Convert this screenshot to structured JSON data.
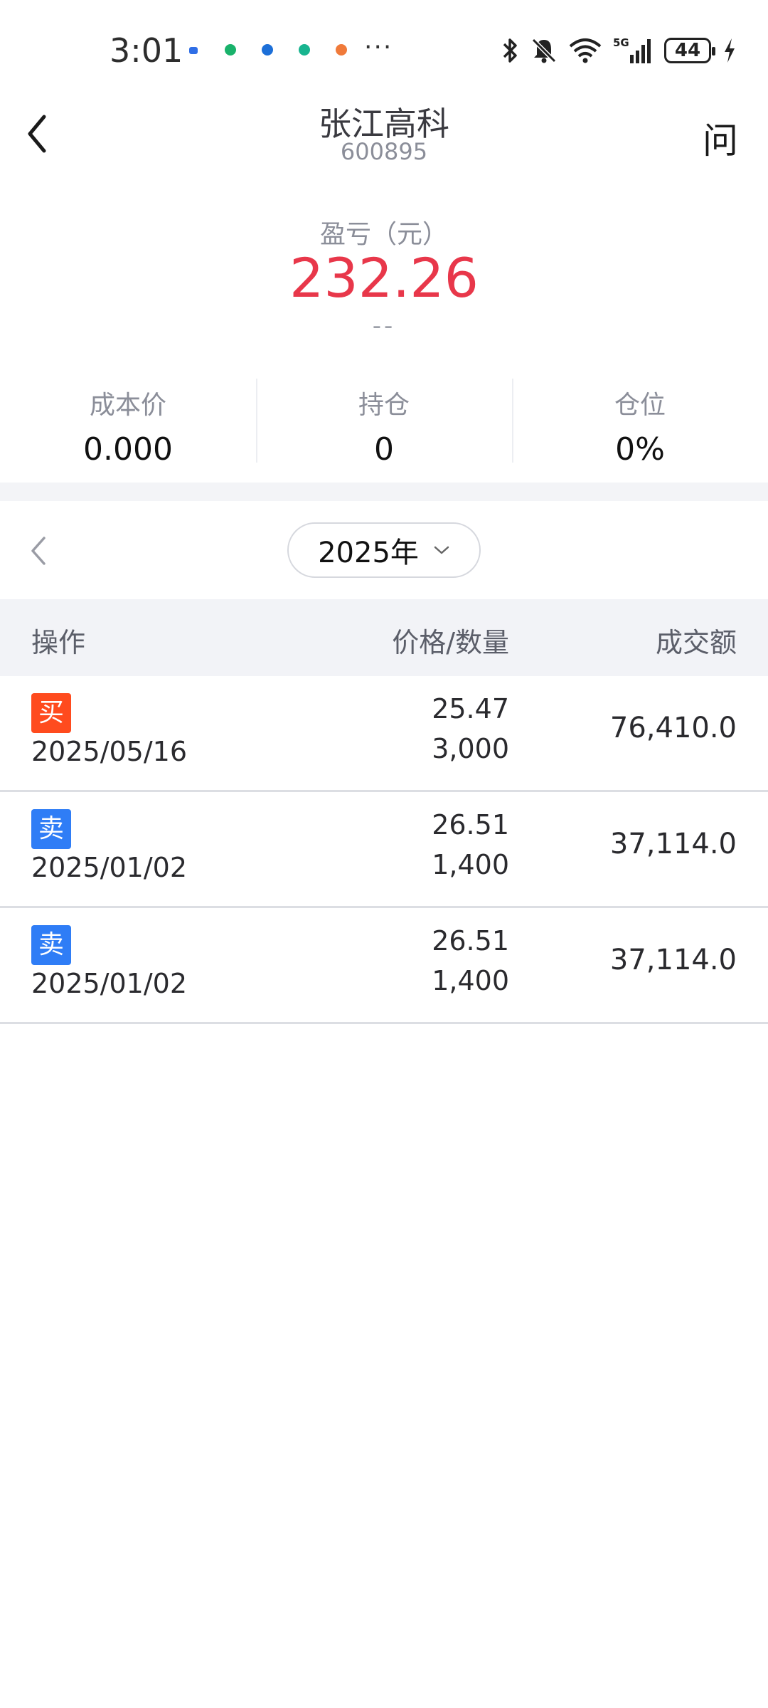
{
  "status_bar": {
    "time": "3:01",
    "more": "···",
    "battery": "44",
    "app_dot_colors": [
      "#2f6ee6",
      "#19b26b",
      "#1c6fd8",
      "#18b48f",
      "#f07a3a"
    ],
    "icons": [
      "bluetooth-icon",
      "mute-icon",
      "wifi-icon",
      "signal-5g-icon",
      "battery-icon",
      "charging-icon"
    ]
  },
  "header": {
    "title": "张江高科",
    "code": "600895",
    "ask_label": "问"
  },
  "summary": {
    "pl_label": "盈亏（元）",
    "pl_value": "232.26",
    "pl_sub": "--",
    "pl_color": "#e8374a",
    "stats": [
      {
        "label": "成本价",
        "value": "0.000"
      },
      {
        "label": "持仓",
        "value": "0"
      },
      {
        "label": "仓位",
        "value": "0%"
      }
    ]
  },
  "year_selector": {
    "year": "2025年"
  },
  "table": {
    "headers": {
      "op": "操作",
      "price_qty": "价格/数量",
      "amount": "成交额"
    },
    "rows": [
      {
        "action": "买",
        "type": "buy",
        "date": "2025/05/16",
        "price": "25.47",
        "qty": "3,000",
        "amount": "76,410.0"
      },
      {
        "action": "卖",
        "type": "sell",
        "date": "2025/01/02",
        "price": "26.51",
        "qty": "1,400",
        "amount": "37,114.0"
      },
      {
        "action": "卖",
        "type": "sell",
        "date": "2025/01/02",
        "price": "26.51",
        "qty": "1,400",
        "amount": "37,114.0"
      }
    ],
    "buy_color": "#ff4b1e",
    "sell_color": "#2f7df6"
  }
}
